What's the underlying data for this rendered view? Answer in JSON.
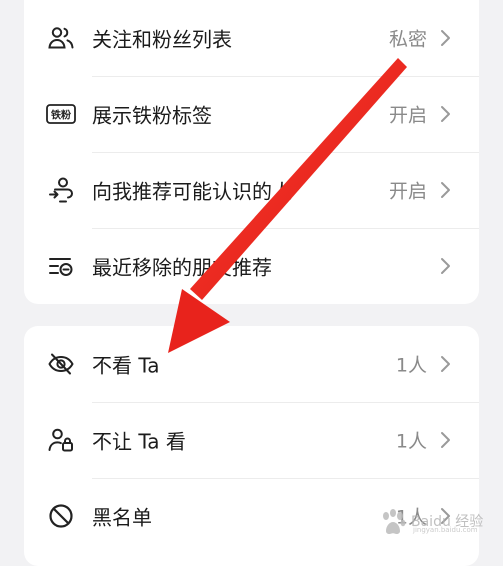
{
  "privacy_section": {
    "items": [
      {
        "label": "关注和粉丝列表",
        "value": "私密",
        "icon": "users-icon"
      },
      {
        "label": "展示铁粉标签",
        "value": "开启",
        "icon": "iron-fan-badge-icon",
        "badge_text": "铁粉"
      },
      {
        "label": "向我推荐可能认识的人",
        "value": "开启",
        "icon": "recommend-people-icon"
      },
      {
        "label": "最近移除的朋友推荐",
        "value": "",
        "icon": "removed-list-icon"
      }
    ]
  },
  "block_section": {
    "items": [
      {
        "label": "不看 Ta",
        "value": "1人",
        "icon": "eye-off-icon"
      },
      {
        "label": "不让 Ta 看",
        "value": "1人",
        "icon": "user-lock-icon"
      },
      {
        "label": "黑名单",
        "value": "1人",
        "icon": "ban-icon"
      }
    ]
  },
  "watermark": {
    "text": "Baidu 经验",
    "sub": "jingyan.baidu.com"
  },
  "colors": {
    "background": "#f2f2f4",
    "card": "#ffffff",
    "text": "#1b1b1b",
    "secondary_text": "#8a8a8a",
    "arrow": "#e8231c"
  }
}
